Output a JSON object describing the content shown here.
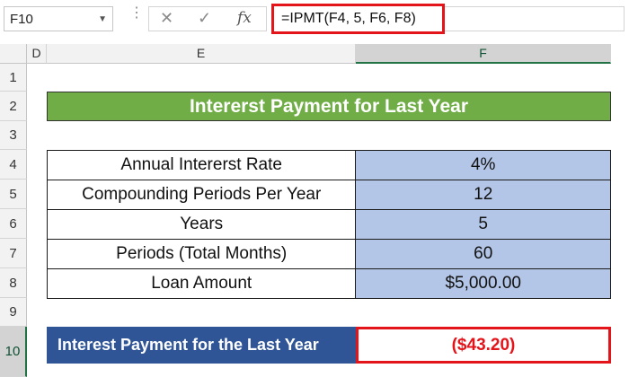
{
  "formula_bar": {
    "name_box": "F10",
    "formula": "=IPMT(F4, 5, F6, F8)",
    "cancel_icon": "✕",
    "enter_icon": "✓",
    "fx_label": "fx"
  },
  "columns": [
    "D",
    "E",
    "F"
  ],
  "rows": [
    "1",
    "2",
    "3",
    "4",
    "5",
    "6",
    "7",
    "8",
    "9",
    "10"
  ],
  "title": "Intererst Payment for Last Year",
  "inputs": [
    {
      "label": "Annual Intererst Rate",
      "value": "4%"
    },
    {
      "label": "Compounding Periods Per Year",
      "value": "12"
    },
    {
      "label": "Years",
      "value": "5"
    },
    {
      "label": "Periods (Total Months)",
      "value": "60"
    },
    {
      "label": "Loan Amount",
      "value": "$5,000.00"
    }
  ],
  "result": {
    "label": "Interest Payment for the Last Year",
    "value": "($43.20)"
  },
  "colors": {
    "title_bg": "#70ad47",
    "input_value_bg": "#b4c6e7",
    "result_label_bg": "#2f5597",
    "highlight": "#e4141b"
  }
}
